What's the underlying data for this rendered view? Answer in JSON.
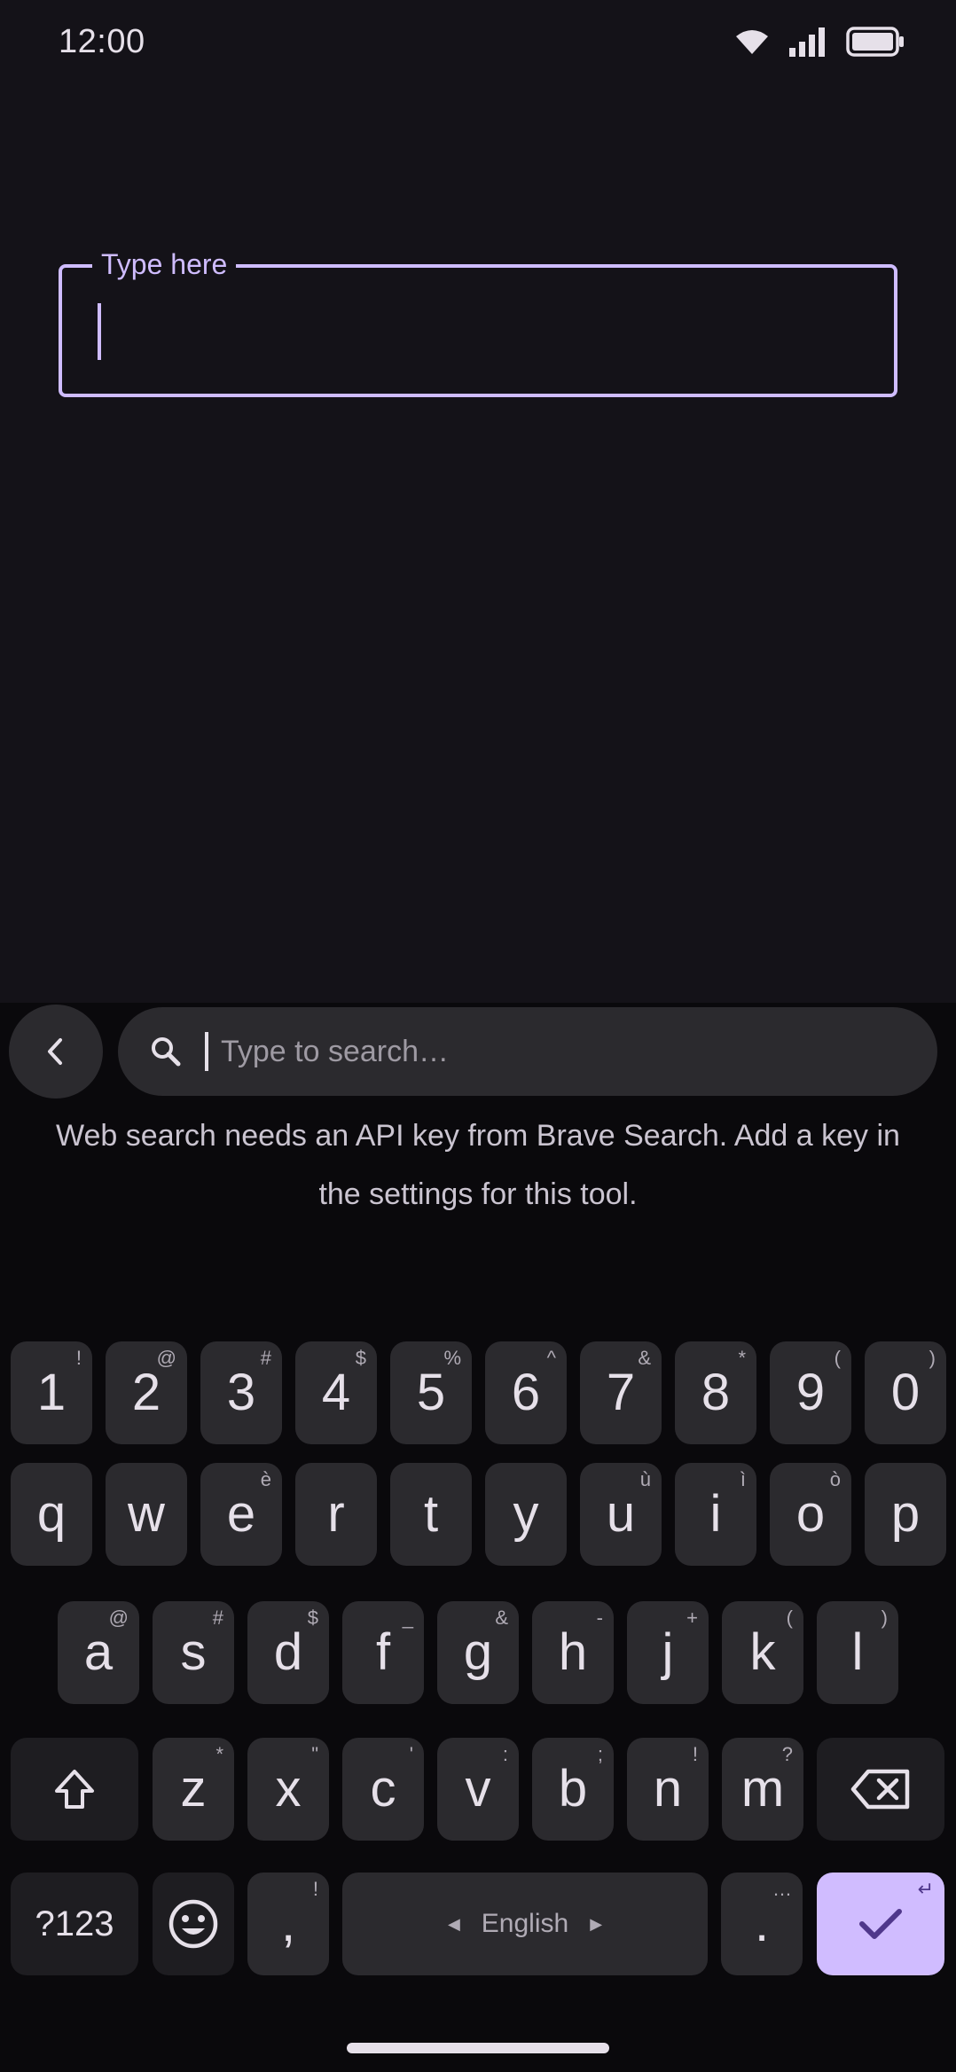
{
  "status_bar": {
    "time": "12:00"
  },
  "text_field": {
    "label": "Type here"
  },
  "search": {
    "placeholder": "Type to search…"
  },
  "notice": "Web search needs an API key from Brave Search. Add a key in the settings for this tool.",
  "keyboard": {
    "row_numbers": [
      {
        "label": "1",
        "hint": "!"
      },
      {
        "label": "2",
        "hint": "@"
      },
      {
        "label": "3",
        "hint": "#"
      },
      {
        "label": "4",
        "hint": "$"
      },
      {
        "label": "5",
        "hint": "%"
      },
      {
        "label": "6",
        "hint": "^"
      },
      {
        "label": "7",
        "hint": "&"
      },
      {
        "label": "8",
        "hint": "*"
      },
      {
        "label": "9",
        "hint": "("
      },
      {
        "label": "0",
        "hint": ")"
      }
    ],
    "row_top": [
      {
        "label": "q",
        "hint": ""
      },
      {
        "label": "w",
        "hint": ""
      },
      {
        "label": "e",
        "hint": "è"
      },
      {
        "label": "r",
        "hint": ""
      },
      {
        "label": "t",
        "hint": ""
      },
      {
        "label": "y",
        "hint": ""
      },
      {
        "label": "u",
        "hint": "ù"
      },
      {
        "label": "i",
        "hint": "ì"
      },
      {
        "label": "o",
        "hint": "ò"
      },
      {
        "label": "p",
        "hint": ""
      }
    ],
    "row_middle": [
      {
        "label": "a",
        "hint": "@"
      },
      {
        "label": "s",
        "hint": "#"
      },
      {
        "label": "d",
        "hint": "$"
      },
      {
        "label": "f",
        "hint": "_"
      },
      {
        "label": "g",
        "hint": "&"
      },
      {
        "label": "h",
        "hint": "-"
      },
      {
        "label": "j",
        "hint": "+"
      },
      {
        "label": "k",
        "hint": "("
      },
      {
        "label": "l",
        "hint": ")"
      }
    ],
    "row_bottom": [
      {
        "label": "z",
        "hint": "*"
      },
      {
        "label": "x",
        "hint": "\""
      },
      {
        "label": "c",
        "hint": "'"
      },
      {
        "label": "v",
        "hint": ":"
      },
      {
        "label": "b",
        "hint": ";"
      },
      {
        "label": "n",
        "hint": "!"
      },
      {
        "label": "m",
        "hint": "?"
      }
    ],
    "symbols_label": "?123",
    "comma": {
      "label": ",",
      "hint": "!"
    },
    "space_label": "English",
    "period": {
      "label": ".",
      "hint": "…"
    },
    "enter_hint": "↵"
  },
  "colors": {
    "accent": "#cfbcff",
    "background": "#141218",
    "key": "#2b2a2e"
  },
  "icons": [
    "wifi-icon",
    "signal-icon",
    "battery-icon",
    "chevron-left-icon",
    "search-icon",
    "shift-icon",
    "backspace-icon",
    "emoji-icon",
    "check-icon"
  ]
}
